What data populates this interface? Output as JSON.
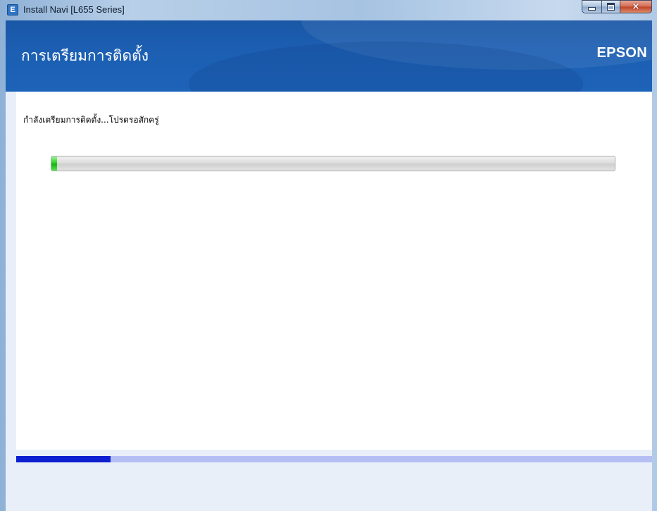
{
  "window": {
    "title": "Install Navi [L655 Series]",
    "icon_letter": "E",
    "minimize_glyph": "minimize-icon",
    "maximize_glyph": "maximize-icon",
    "close_glyph": "×"
  },
  "header": {
    "title": "การเตรียมการติดตั้ง",
    "logo": "EPSON"
  },
  "content": {
    "status_text": "กำลังเตรียมการติดตั้ง...โปรดรอสักครู่",
    "progress_fraction": 0.01
  },
  "steps": {
    "progress_fraction": 0.148
  },
  "colors": {
    "header_blue": "#1c5fb3",
    "progress_green": "#2fcf2a",
    "step_fill": "#0d1fd0",
    "step_track": "#b6bff4"
  }
}
